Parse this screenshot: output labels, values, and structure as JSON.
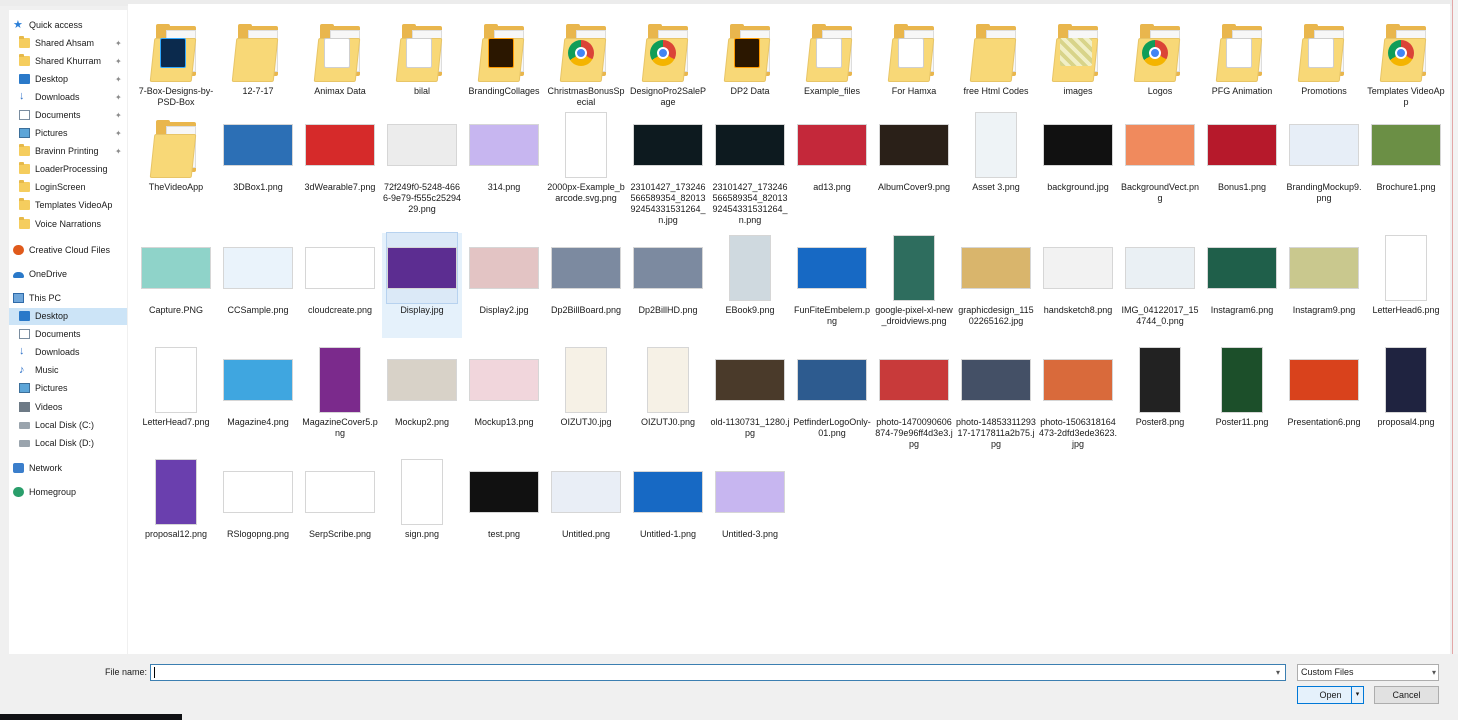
{
  "sidebar": {
    "items": [
      {
        "label": "Quick access",
        "icon": "star-icon",
        "pinned": false
      },
      {
        "label": "Shared Ahsam",
        "icon": "folder-icon",
        "pinned": true
      },
      {
        "label": "Shared Khurram",
        "icon": "folder-icon",
        "pinned": true
      },
      {
        "label": "Desktop",
        "icon": "desktop-icon",
        "pinned": true
      },
      {
        "label": "Downloads",
        "icon": "download-icon",
        "pinned": true
      },
      {
        "label": "Documents",
        "icon": "documents-icon",
        "pinned": true
      },
      {
        "label": "Pictures",
        "icon": "pictures-icon",
        "pinned": true
      },
      {
        "label": "Bravinn Printing",
        "icon": "folder-icon",
        "pinned": true
      },
      {
        "label": "LoaderProcessing",
        "icon": "folder-icon",
        "pinned": false
      },
      {
        "label": "LoginScreen",
        "icon": "folder-icon",
        "pinned": false
      },
      {
        "label": "Templates VideoAp",
        "icon": "folder-icon",
        "pinned": false
      },
      {
        "label": "Voice Narrations",
        "icon": "folder-icon",
        "pinned": false
      },
      {
        "label": "Creative Cloud Files",
        "icon": "creative-cloud-icon",
        "pinned": false
      },
      {
        "label": "OneDrive",
        "icon": "onedrive-icon",
        "pinned": false
      },
      {
        "label": "This PC",
        "icon": "computer-icon",
        "pinned": false
      },
      {
        "label": "Desktop",
        "icon": "desktop-icon",
        "pinned": false,
        "selected": true
      },
      {
        "label": "Documents",
        "icon": "documents-icon",
        "pinned": false
      },
      {
        "label": "Downloads",
        "icon": "download-icon",
        "pinned": false
      },
      {
        "label": "Music",
        "icon": "music-icon",
        "pinned": false
      },
      {
        "label": "Pictures",
        "icon": "pictures-icon",
        "pinned": false
      },
      {
        "label": "Videos",
        "icon": "videos-icon",
        "pinned": false
      },
      {
        "label": "Local Disk (C:)",
        "icon": "drive-icon",
        "pinned": false
      },
      {
        "label": "Local Disk (D:)",
        "icon": "drive-icon",
        "pinned": false
      },
      {
        "label": "Network",
        "icon": "network-icon",
        "pinned": false
      },
      {
        "label": "Homegroup",
        "icon": "homegroup-icon",
        "pinned": false
      }
    ],
    "pin_glyph": "📌"
  },
  "files": [
    {
      "name": "7-Box-Designs-by-PSD-Box",
      "kind": "folder",
      "badge": "ps"
    },
    {
      "name": "12-7-17",
      "kind": "folder"
    },
    {
      "name": "Animax Data",
      "kind": "folder",
      "badge": "doc"
    },
    {
      "name": "bilal",
      "kind": "folder",
      "badge": "doc"
    },
    {
      "name": "BrandingCollages",
      "kind": "folder",
      "badge": "ai"
    },
    {
      "name": "ChristmasBonusSpecial",
      "kind": "folder",
      "badge": "chrome"
    },
    {
      "name": "DesignoPro2SalePage",
      "kind": "folder",
      "badge": "chrome"
    },
    {
      "name": "DP2 Data",
      "kind": "folder",
      "badge": "ai"
    },
    {
      "name": "Example_files",
      "kind": "folder",
      "badge": "doc"
    },
    {
      "name": "For Hamxa",
      "kind": "folder",
      "badge": "doc"
    },
    {
      "name": "free Html Codes",
      "kind": "folder"
    },
    {
      "name": "images",
      "kind": "folder",
      "badge": "pattern"
    },
    {
      "name": "Logos",
      "kind": "folder",
      "badge": "chrome"
    },
    {
      "name": "PFG Animation",
      "kind": "folder",
      "badge": "doc"
    },
    {
      "name": "Promotions",
      "kind": "folder",
      "badge": "doc"
    },
    {
      "name": "Templates VideoApp",
      "kind": "folder",
      "badge": "chrome"
    },
    {
      "name": "TheVideoApp",
      "kind": "folder"
    },
    {
      "name": "3DBox1.png",
      "kind": "image",
      "color": "#2c6fb5"
    },
    {
      "name": "3dWearable7.png",
      "kind": "image",
      "color": "#d62a2a"
    },
    {
      "name": "72f249f0-5248-4666-9e79-f555c2529429.png",
      "kind": "image",
      "color": "#ececec"
    },
    {
      "name": "314.png",
      "kind": "image",
      "color": "#c7b6f0"
    },
    {
      "name": "2000px-Example_barcode.svg.png",
      "kind": "image",
      "color": "#ffffff"
    },
    {
      "name": "23101427_173246566589354_8201392454331531264_n.jpg",
      "kind": "image",
      "color": "#0d1a1f"
    },
    {
      "name": "23101427_173246566589354_8201392454331531264_n.png",
      "kind": "image",
      "color": "#0d1a1f"
    },
    {
      "name": "ad13.png",
      "kind": "image",
      "color": "#c4283a"
    },
    {
      "name": "AlbumCover9.png",
      "kind": "image",
      "color": "#2a2018"
    },
    {
      "name": "Asset 3.png",
      "kind": "image",
      "color": "#eef3f6"
    },
    {
      "name": "background.jpg",
      "kind": "image",
      "color": "#111111"
    },
    {
      "name": "BackgroundVect.png",
      "kind": "image",
      "color": "#f08a5d"
    },
    {
      "name": "Bonus1.png",
      "kind": "image",
      "color": "#b6192b"
    },
    {
      "name": "BrandingMockup9.png",
      "kind": "image",
      "color": "#e7eef7"
    },
    {
      "name": "Brochure1.png",
      "kind": "image",
      "color": "#6b8f45"
    },
    {
      "name": "Capture.PNG",
      "kind": "image",
      "color": "#8fd3c9"
    },
    {
      "name": "CCSample.png",
      "kind": "image",
      "color": "#eaf3fb"
    },
    {
      "name": "cloudcreate.png",
      "kind": "image",
      "color": "#ffffff"
    },
    {
      "name": "Display.jpg",
      "kind": "image",
      "color": "#5c2d91",
      "selected": true
    },
    {
      "name": "Display2.jpg",
      "kind": "image",
      "color": "#e3c4c4"
    },
    {
      "name": "Dp2BillBoard.png",
      "kind": "image",
      "color": "#7c8aa0"
    },
    {
      "name": "Dp2BillHD.png",
      "kind": "image",
      "color": "#7c8aa0"
    },
    {
      "name": "EBook9.png",
      "kind": "image",
      "color": "#cfd9df"
    },
    {
      "name": "FunFiteEmbelem.png",
      "kind": "image",
      "color": "#1769c4"
    },
    {
      "name": "google-pixel-xl-new_droidviews.png",
      "kind": "image",
      "color": "#2e6d5e"
    },
    {
      "name": "graphicdesign_11502265162.jpg",
      "kind": "image",
      "color": "#d9b56c"
    },
    {
      "name": "handsketch8.png",
      "kind": "image",
      "color": "#f2f2f2"
    },
    {
      "name": "IMG_04122017_154744_0.png",
      "kind": "image",
      "color": "#eaf0f4"
    },
    {
      "name": "Instagram6.png",
      "kind": "image",
      "color": "#1f5f4a"
    },
    {
      "name": "Instagram9.png",
      "kind": "image",
      "color": "#c9c88e"
    },
    {
      "name": "LetterHead6.png",
      "kind": "image",
      "color": "#ffffff"
    },
    {
      "name": "LetterHead7.png",
      "kind": "image",
      "color": "#ffffff"
    },
    {
      "name": "Magazine4.png",
      "kind": "image",
      "color": "#3fa6e0"
    },
    {
      "name": "MagazineCover5.png",
      "kind": "image",
      "color": "#7b2a8c"
    },
    {
      "name": "Mockup2.png",
      "kind": "image",
      "color": "#d8d2c8"
    },
    {
      "name": "Mockup13.png",
      "kind": "image",
      "color": "#f1d6dc"
    },
    {
      "name": "OIZUTJ0.jpg",
      "kind": "image",
      "color": "#f6f1e6"
    },
    {
      "name": "OIZUTJ0.png",
      "kind": "image",
      "color": "#f6f1e6"
    },
    {
      "name": "old-1130731_1280.jpg",
      "kind": "image",
      "color": "#4a3a2a"
    },
    {
      "name": "PetfinderLogoOnly-01.png",
      "kind": "image",
      "color": "#2d5b8f"
    },
    {
      "name": "photo-1470090606874-79e96ff4d3e3.jpg",
      "kind": "image",
      "color": "#c83a3a"
    },
    {
      "name": "photo-1485331129317-1717811a2b75.jpg",
      "kind": "image",
      "color": "#445066"
    },
    {
      "name": "photo-1506318164473-2dfd3ede3623.jpg",
      "kind": "image",
      "color": "#d96a3b"
    },
    {
      "name": "Poster8.png",
      "kind": "image",
      "color": "#222222"
    },
    {
      "name": "Poster11.png",
      "kind": "image",
      "color": "#1c4f2a"
    },
    {
      "name": "Presentation6.png",
      "kind": "image",
      "color": "#d9421c"
    },
    {
      "name": "proposal4.png",
      "kind": "image",
      "color": "#1f2340"
    },
    {
      "name": "proposal12.png",
      "kind": "image",
      "color": "#6a3fae"
    },
    {
      "name": "RSlogopng.png",
      "kind": "image",
      "color": "#ffffff"
    },
    {
      "name": "SerpScribe.png",
      "kind": "image",
      "color": "#ffffff"
    },
    {
      "name": "sign.png",
      "kind": "image",
      "color": "#ffffff"
    },
    {
      "name": "test.png",
      "kind": "image",
      "color": "#111111"
    },
    {
      "name": "Untitled.png",
      "kind": "image",
      "color": "#e9eef6"
    },
    {
      "name": "Untitled-1.png",
      "kind": "image",
      "color": "#1769c4"
    },
    {
      "name": "Untitled-3.png",
      "kind": "image",
      "color": "#c7b6f0"
    }
  ],
  "footer": {
    "file_name_label": "File name:",
    "file_name_value": "",
    "filter_value": "Custom Files",
    "open_label": "Open",
    "cancel_label": "Cancel",
    "dropdown_glyph": "▾"
  }
}
